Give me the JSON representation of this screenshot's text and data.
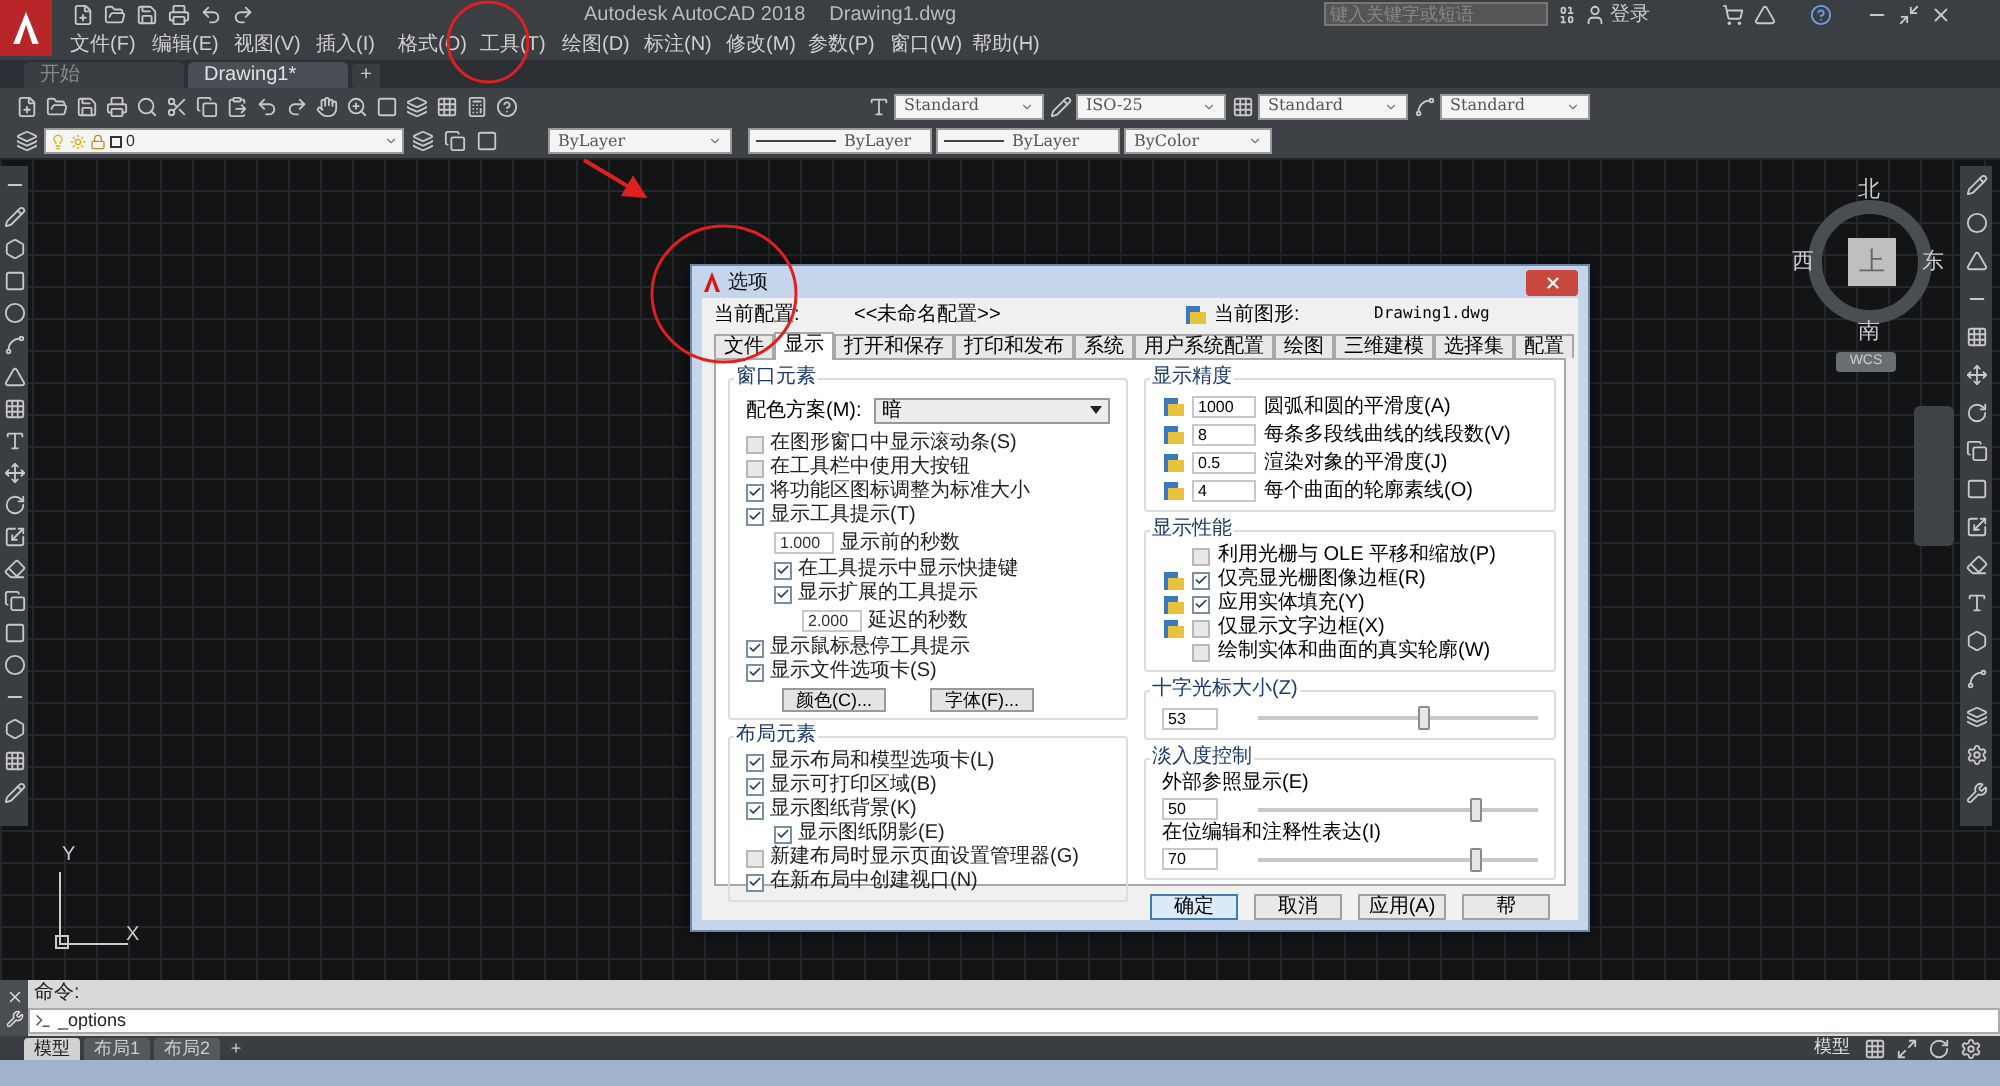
{
  "app": {
    "title": "Autodesk AutoCAD 2018",
    "document": "Drawing1.dwg",
    "search_placeholder": "键入关键字或短语",
    "sign_in": "登录"
  },
  "menu": [
    "文件(F)",
    "编辑(E)",
    "视图(V)",
    "插入(I)",
    "格式(O)",
    "工具(T)",
    "绘图(D)",
    "标注(N)",
    "修改(M)",
    "参数(P)",
    "窗口(W)",
    "帮助(H)"
  ],
  "file_tabs": [
    {
      "label": "开始",
      "selected": false
    },
    {
      "label": "Drawing1*",
      "selected": true
    }
  ],
  "new_tab_button": "+",
  "styles_toolbar": {
    "text_style": "Standard",
    "dim_style": "ISO-25",
    "table_style": "Standard",
    "multileader_style": "Standard"
  },
  "layers_toolbar": {
    "layer": "0",
    "color_setting": "ByLayer",
    "linetype": "ByLayer",
    "lineweight": "ByLayer",
    "plot_style": "ByColor"
  },
  "viewcube": {
    "north": "北",
    "west": "西",
    "top": "上",
    "east": "东",
    "south": "南",
    "ucs": "WCS"
  },
  "ucs_icon": {
    "y": "Y",
    "x": "X"
  },
  "dialog": {
    "title": "选项",
    "current_profile_label": "当前配置:",
    "current_profile": "<<未命名配置>>",
    "current_drawing_label": "当前图形:",
    "current_drawing": "Drawing1.dwg",
    "tabs": [
      {
        "label": "文件",
        "selected": false
      },
      {
        "label": "显示",
        "selected": true
      },
      {
        "label": "打开和保存",
        "selected": false
      },
      {
        "label": "打印和发布",
        "selected": false
      },
      {
        "label": "系统",
        "selected": false
      },
      {
        "label": "用户系统配置",
        "selected": false
      },
      {
        "label": "绘图",
        "selected": false
      },
      {
        "label": "三维建模",
        "selected": false
      },
      {
        "label": "选择集",
        "selected": false
      },
      {
        "label": "配置",
        "selected": false
      }
    ],
    "window_elements": {
      "title": "窗口元素",
      "color_scheme_label": "配色方案(M):",
      "color_scheme": "暗",
      "options": [
        {
          "kind": "checkbox",
          "label": "在图形窗口中显示滚动条(S)",
          "checked": false
        },
        {
          "kind": "checkbox",
          "label": "在工具栏中使用大按钮",
          "checked": false
        },
        {
          "kind": "checkbox",
          "label": "将功能区图标调整为标准大小",
          "checked": true
        },
        {
          "kind": "checkbox",
          "label": "显示工具提示(T)",
          "checked": true,
          "children": [
            {
              "kind": "number",
              "value": "1.000",
              "label": "显示前的秒数"
            },
            {
              "kind": "checkbox",
              "label": "在工具提示中显示快捷键",
              "checked": true
            },
            {
              "kind": "checkbox",
              "label": "显示扩展的工具提示",
              "checked": true,
              "children": [
                {
                  "kind": "number",
                  "value": "2.000",
                  "label": "延迟的秒数"
                }
              ]
            }
          ]
        },
        {
          "kind": "checkbox",
          "label": "显示鼠标悬停工具提示",
          "checked": true
        },
        {
          "kind": "checkbox",
          "label": "显示文件选项卡(S)",
          "checked": true
        }
      ],
      "buttons": [
        "颜色(C)...",
        "字体(F)..."
      ]
    },
    "layout_elements": {
      "title": "布局元素",
      "options": [
        {
          "kind": "checkbox",
          "label": "显示布局和模型选项卡(L)",
          "checked": true
        },
        {
          "kind": "checkbox",
          "label": "显示可打印区域(B)",
          "checked": true
        },
        {
          "kind": "checkbox",
          "label": "显示图纸背景(K)",
          "checked": true,
          "children": [
            {
              "kind": "checkbox",
              "label": "显示图纸阴影(E)",
              "checked": true
            }
          ]
        },
        {
          "kind": "checkbox",
          "label": "新建布局时显示页面设置管理器(G)",
          "checked": false
        },
        {
          "kind": "checkbox",
          "label": "在新布局中创建视口(N)",
          "checked": true
        }
      ]
    },
    "display_resolution": {
      "title": "显示精度",
      "items": [
        {
          "value": "1000",
          "label": "圆弧和圆的平滑度(A)"
        },
        {
          "value": "8",
          "label": "每条多段线曲线的线段数(V)"
        },
        {
          "value": "0.5",
          "label": "渲染对象的平滑度(J)"
        },
        {
          "value": "4",
          "label": "每个曲面的轮廓素线(O)"
        }
      ]
    },
    "display_performance": {
      "title": "显示性能",
      "items": [
        {
          "label": "利用光栅与 OLE 平移和缩放(P)",
          "checked": false,
          "drawing_icon": false
        },
        {
          "label": "仅亮显光栅图像边框(R)",
          "checked": true,
          "drawing_icon": true
        },
        {
          "label": "应用实体填充(Y)",
          "checked": true,
          "drawing_icon": true
        },
        {
          "label": "仅显示文字边框(X)",
          "checked": false,
          "drawing_icon": true
        },
        {
          "label": "绘制实体和曲面的真实轮廓(W)",
          "checked": false,
          "drawing_icon": false
        }
      ]
    },
    "crosshair": {
      "title": "十字光标大小(Z)",
      "value": "53",
      "level": 0.59
    },
    "fade_control": {
      "title": "淡入度控制",
      "items": [
        {
          "label": "外部参照显示(E)",
          "value": "50",
          "level": 0.78
        },
        {
          "label": "在位编辑和注释性表达(I)",
          "value": "70",
          "level": 0.78
        }
      ]
    },
    "buttons": [
      {
        "label": "确定",
        "kind": "default"
      },
      {
        "label": "取消",
        "kind": "normal"
      },
      {
        "label": "应用(A)",
        "kind": "normal"
      },
      {
        "label": "帮",
        "kind": "normal"
      }
    ]
  },
  "command_line": {
    "label": "命令:",
    "input": "_options"
  },
  "layout_tabs": [
    {
      "label": "模型",
      "selected": true
    },
    {
      "label": "布局1",
      "selected": false
    },
    {
      "label": "布局2",
      "selected": false
    }
  ],
  "add_layout_button": "+",
  "status_bar": {
    "space": "模型"
  }
}
